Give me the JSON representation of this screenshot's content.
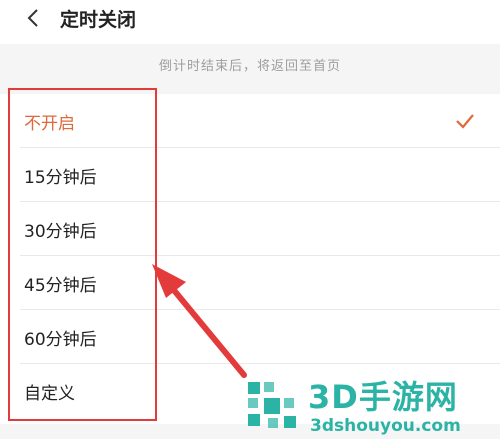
{
  "header": {
    "back_icon": "chevron-left-icon",
    "title": "定时关闭"
  },
  "hint": "倒计时结束后，将返回至首页",
  "options": [
    {
      "label": "不开启",
      "selected": true
    },
    {
      "label": "15分钟后",
      "selected": false
    },
    {
      "label": "30分钟后",
      "selected": false
    },
    {
      "label": "45分钟后",
      "selected": false
    },
    {
      "label": "60分钟后",
      "selected": false
    },
    {
      "label": "自定义",
      "selected": false
    }
  ],
  "colors": {
    "accent": "#e0683b",
    "annotation": "#e33b3b",
    "watermark": "#2bb3a5"
  },
  "watermark": {
    "brand": "3D手游网",
    "domain": "3dshouyou.com"
  }
}
